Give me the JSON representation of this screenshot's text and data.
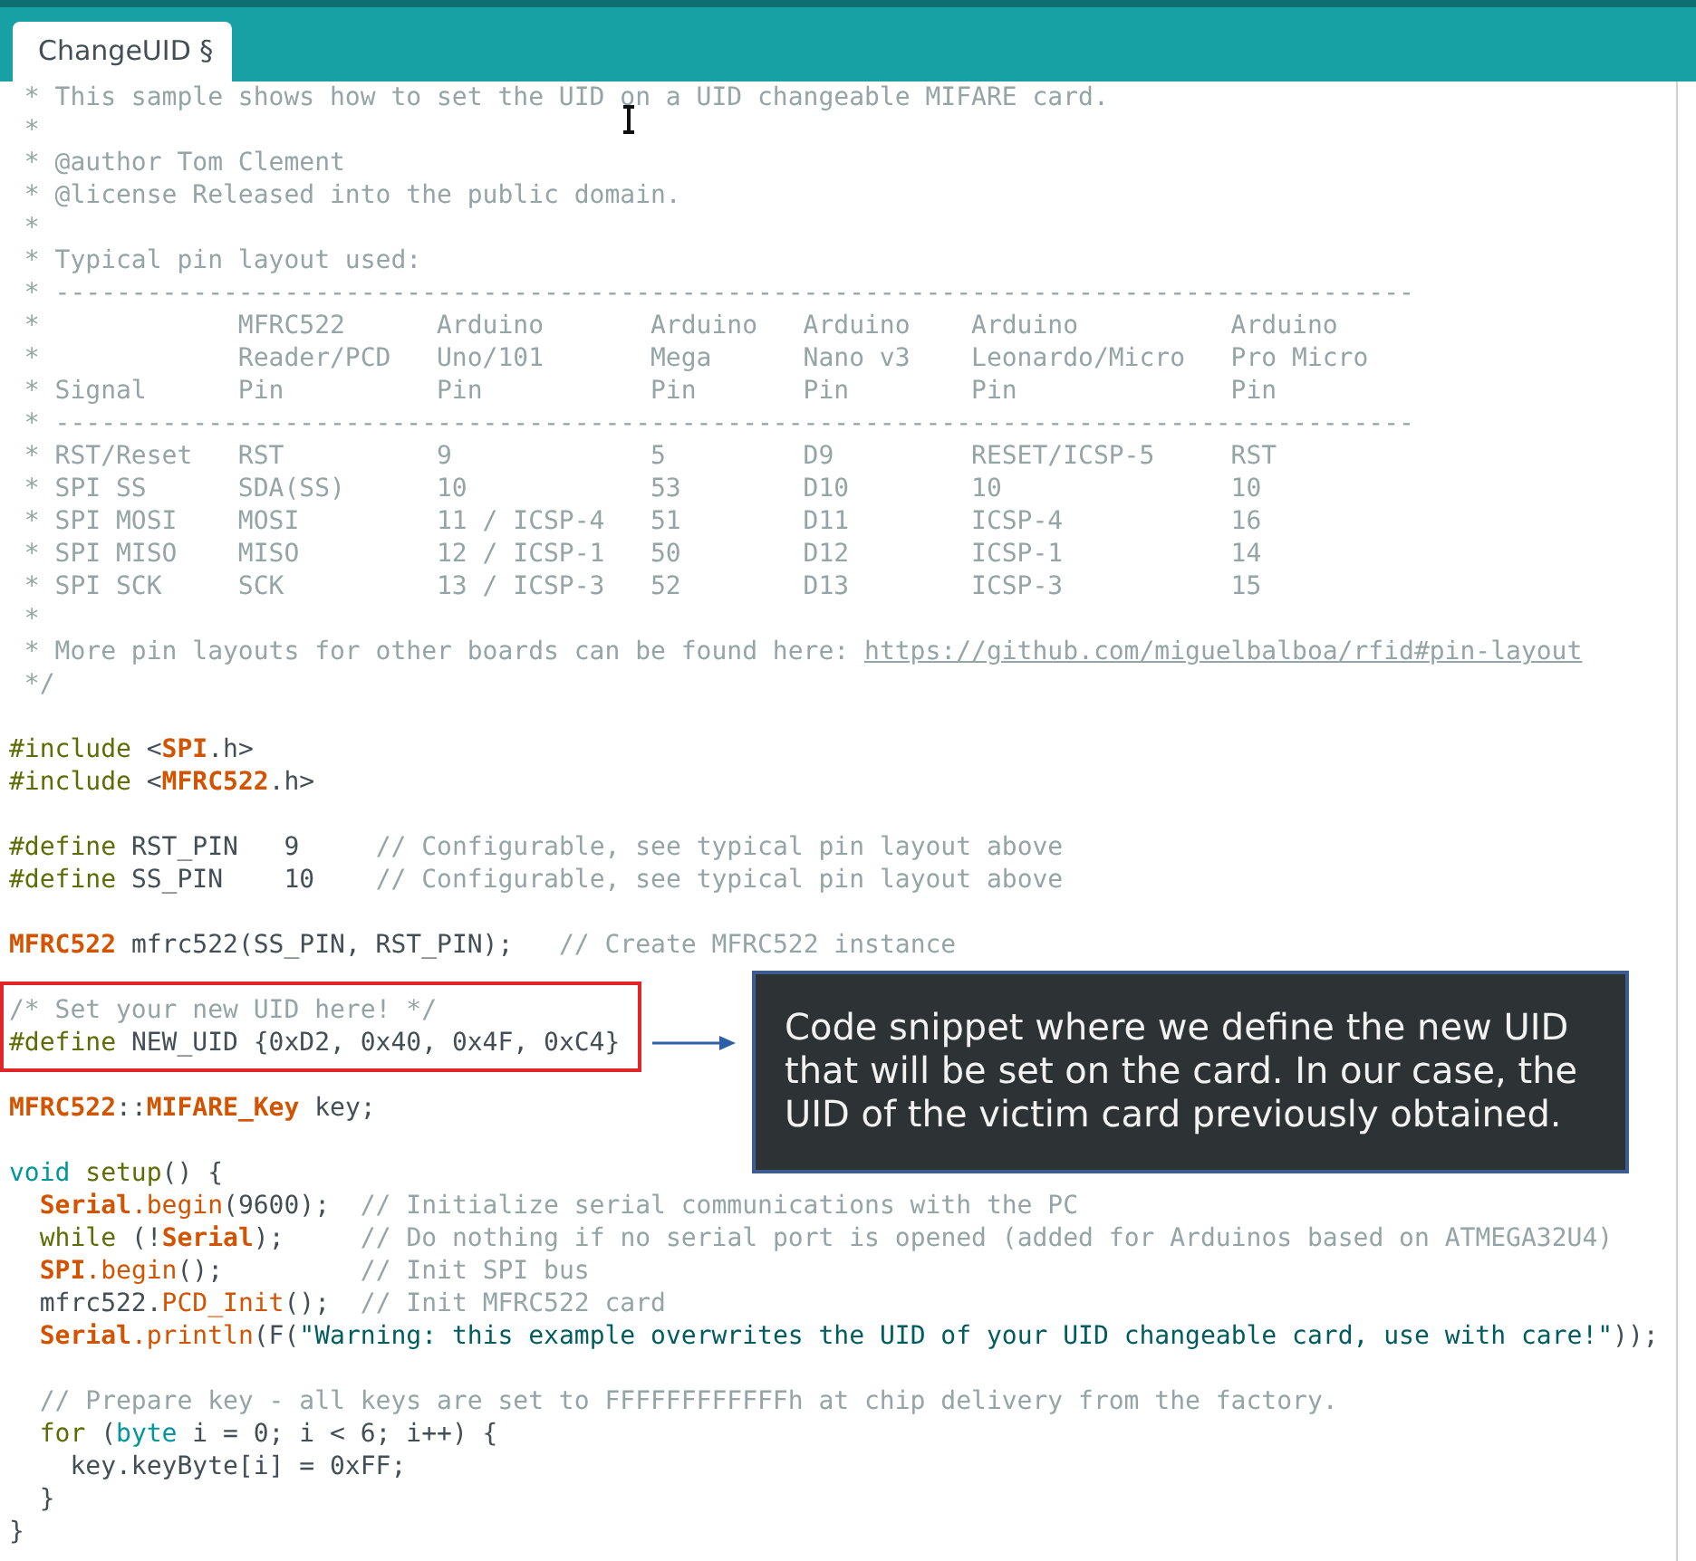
{
  "tabs": [
    {
      "label": "ChangeUID §",
      "selected": true
    }
  ],
  "editor": {
    "lines": [
      {
        "boxed": false,
        "tokens": [
          {
            "kind": "comment",
            "text": " * This sample shows how to set the UID on a UID changeable MIFARE card."
          }
        ]
      },
      {
        "boxed": false,
        "tokens": [
          {
            "kind": "comment",
            "text": " *"
          }
        ]
      },
      {
        "boxed": false,
        "tokens": [
          {
            "kind": "comment",
            "text": " * @author Tom Clement"
          }
        ]
      },
      {
        "boxed": false,
        "tokens": [
          {
            "kind": "comment",
            "text": " * @license Released into the public domain."
          }
        ]
      },
      {
        "boxed": false,
        "tokens": [
          {
            "kind": "comment",
            "text": " *"
          }
        ]
      },
      {
        "boxed": false,
        "tokens": [
          {
            "kind": "comment",
            "text": " * Typical pin layout used:"
          }
        ]
      },
      {
        "boxed": false,
        "tokens": [
          {
            "kind": "comment",
            "text": " * -----------------------------------------------------------------------------------------"
          }
        ]
      },
      {
        "boxed": false,
        "tokens": [
          {
            "kind": "comment",
            "text": " *             MFRC522      Arduino       Arduino   Arduino    Arduino          Arduino"
          }
        ]
      },
      {
        "boxed": false,
        "tokens": [
          {
            "kind": "comment",
            "text": " *             Reader/PCD   Uno/101       Mega      Nano v3    Leonardo/Micro   Pro Micro"
          }
        ]
      },
      {
        "boxed": false,
        "tokens": [
          {
            "kind": "comment",
            "text": " * Signal      Pin          Pin           Pin       Pin        Pin              Pin"
          }
        ]
      },
      {
        "boxed": false,
        "tokens": [
          {
            "kind": "comment",
            "text": " * -----------------------------------------------------------------------------------------"
          }
        ]
      },
      {
        "boxed": false,
        "tokens": [
          {
            "kind": "comment",
            "text": " * RST/Reset   RST          9             5         D9         RESET/ICSP-5     RST"
          }
        ]
      },
      {
        "boxed": false,
        "tokens": [
          {
            "kind": "comment",
            "text": " * SPI SS      SDA(SS)      10            53        D10        10               10"
          }
        ]
      },
      {
        "boxed": false,
        "tokens": [
          {
            "kind": "comment",
            "text": " * SPI MOSI    MOSI         11 / ICSP-4   51        D11        ICSP-4           16"
          }
        ]
      },
      {
        "boxed": false,
        "tokens": [
          {
            "kind": "comment",
            "text": " * SPI MISO    MISO         12 / ICSP-1   50        D12        ICSP-1           14"
          }
        ]
      },
      {
        "boxed": false,
        "tokens": [
          {
            "kind": "comment",
            "text": " * SPI SCK     SCK          13 / ICSP-3   52        D13        ICSP-3           15"
          }
        ]
      },
      {
        "boxed": false,
        "tokens": [
          {
            "kind": "comment",
            "text": " *"
          }
        ]
      },
      {
        "boxed": false,
        "tokens": [
          {
            "kind": "comment",
            "text": " * More pin layouts for other boards can be found here: "
          },
          {
            "kind": "link",
            "text": "https://github.com/miguelbalboa/rfid#pin-layout"
          }
        ]
      },
      {
        "boxed": false,
        "tokens": [
          {
            "kind": "comment",
            "text": " */"
          }
        ]
      },
      {
        "boxed": false
      },
      {
        "boxed": false,
        "tokens": [
          {
            "kind": "directive",
            "text": "#include"
          },
          {
            "kind": "plain",
            "text": " <"
          },
          {
            "kind": "class",
            "text": "SPI"
          },
          {
            "kind": "plain",
            "text": ".h>"
          }
        ]
      },
      {
        "boxed": false,
        "tokens": [
          {
            "kind": "directive",
            "text": "#include"
          },
          {
            "kind": "plain",
            "text": " <"
          },
          {
            "kind": "class",
            "text": "MFRC522"
          },
          {
            "kind": "plain",
            "text": ".h>"
          }
        ]
      },
      {
        "boxed": false
      },
      {
        "boxed": false,
        "tokens": [
          {
            "kind": "directive",
            "text": "#define"
          },
          {
            "kind": "plain",
            "text": " RST_PIN   9     "
          },
          {
            "kind": "comment",
            "text": "// Configurable, see typical pin layout above"
          }
        ]
      },
      {
        "boxed": false,
        "tokens": [
          {
            "kind": "directive",
            "text": "#define"
          },
          {
            "kind": "plain",
            "text": " SS_PIN    10    "
          },
          {
            "kind": "comment",
            "text": "// Configurable, see typical pin layout above"
          }
        ]
      },
      {
        "boxed": false
      },
      {
        "boxed": false,
        "tokens": [
          {
            "kind": "class",
            "text": "MFRC522"
          },
          {
            "kind": "plain",
            "text": " mfrc522(SS_PIN, RST_PIN);   "
          },
          {
            "kind": "comment",
            "text": "// Create MFRC522 instance"
          }
        ]
      },
      {
        "boxed": false
      },
      {
        "boxed": true,
        "tokens": [
          {
            "kind": "comment",
            "text": "/* Set your new UID here! */"
          }
        ]
      },
      {
        "boxed": true,
        "tokens": [
          {
            "kind": "directive",
            "text": "#define"
          },
          {
            "kind": "plain",
            "text": " NEW_UID {0xD2, 0x40, 0x4F, 0xC4}"
          }
        ]
      },
      {
        "boxed": false
      },
      {
        "boxed": false,
        "tokens": [
          {
            "kind": "class",
            "text": "MFRC522"
          },
          {
            "kind": "plain",
            "text": "::"
          },
          {
            "kind": "class",
            "text": "MIFARE_Key"
          },
          {
            "kind": "plain",
            "text": " key;"
          }
        ]
      },
      {
        "boxed": false
      },
      {
        "boxed": false,
        "tokens": [
          {
            "kind": "type",
            "text": "void"
          },
          {
            "kind": "control",
            "text": " setup"
          },
          {
            "kind": "plain",
            "text": "() {"
          }
        ]
      },
      {
        "boxed": false,
        "tokens": [
          {
            "kind": "class",
            "text": "  Serial"
          },
          {
            "kind": "method",
            "text": ".begin"
          },
          {
            "kind": "plain",
            "text": "(9600);  "
          },
          {
            "kind": "comment",
            "text": "// Initialize serial communications with the PC"
          }
        ]
      },
      {
        "boxed": false,
        "tokens": [
          {
            "kind": "control",
            "text": "  while"
          },
          {
            "kind": "plain",
            "text": " (!"
          },
          {
            "kind": "class",
            "text": "Serial"
          },
          {
            "kind": "plain",
            "text": ");     "
          },
          {
            "kind": "comment",
            "text": "// Do nothing if no serial port is opened (added for Arduinos based on ATMEGA32U4)"
          }
        ]
      },
      {
        "boxed": false,
        "tokens": [
          {
            "kind": "class",
            "text": "  SPI"
          },
          {
            "kind": "method",
            "text": ".begin"
          },
          {
            "kind": "plain",
            "text": "();         "
          },
          {
            "kind": "comment",
            "text": "// Init SPI bus"
          }
        ]
      },
      {
        "boxed": false,
        "tokens": [
          {
            "kind": "plain",
            "text": "  mfrc522."
          },
          {
            "kind": "method",
            "text": "PCD_Init"
          },
          {
            "kind": "plain",
            "text": "();  "
          },
          {
            "kind": "comment",
            "text": "// Init MFRC522 card"
          }
        ]
      },
      {
        "boxed": false,
        "tokens": [
          {
            "kind": "class",
            "text": "  Serial"
          },
          {
            "kind": "method",
            "text": ".println"
          },
          {
            "kind": "plain",
            "text": "(F("
          },
          {
            "kind": "string",
            "text": "\"Warning: this example overwrites the UID of your UID changeable card, use with care!\""
          },
          {
            "kind": "plain",
            "text": "));"
          }
        ]
      },
      {
        "boxed": false
      },
      {
        "boxed": false,
        "tokens": [
          {
            "kind": "comment",
            "text": "  // Prepare key - all keys are set to FFFFFFFFFFFFh at chip delivery from the factory."
          }
        ]
      },
      {
        "boxed": false,
        "tokens": [
          {
            "kind": "control",
            "text": "  for"
          },
          {
            "kind": "plain",
            "text": " ("
          },
          {
            "kind": "type",
            "text": "byte"
          },
          {
            "kind": "plain",
            "text": " i = 0; i < 6; i++) {"
          }
        ]
      },
      {
        "boxed": false,
        "tokens": [
          {
            "kind": "plain",
            "text": "    key.keyByte[i] = 0xFF;"
          }
        ]
      },
      {
        "boxed": false,
        "tokens": [
          {
            "kind": "plain",
            "text": "  }"
          }
        ]
      },
      {
        "boxed": false,
        "tokens": [
          {
            "kind": "plain",
            "text": "}"
          }
        ]
      }
    ],
    "callout": {
      "text": "Code snippet where we define the new UID that will be set on the card. In our case, the UID of the victim card previously obtained."
    }
  }
}
